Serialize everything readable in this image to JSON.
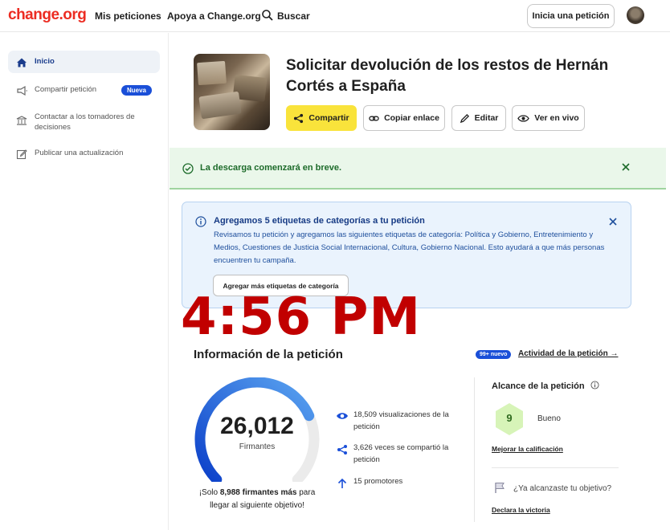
{
  "topnav": {
    "logo": "change.org",
    "links": [
      "Mis peticiones",
      "Apoya a Change.org"
    ],
    "search_label": "Buscar",
    "start_petition_label": "Inicia una petición"
  },
  "sidebar": {
    "items": [
      {
        "label": "Inicio",
        "icon": "home-icon",
        "active": true
      },
      {
        "label": "Compartir petición",
        "icon": "megaphone-icon",
        "badge": "Nueva"
      },
      {
        "label": "Contactar a los tomadores de decisiones",
        "icon": "building-icon"
      },
      {
        "label": "Publicar una actualización",
        "icon": "edit-icon"
      }
    ]
  },
  "petition": {
    "title": "Solicitar devolución de los restos de Hernán Cortés a España",
    "actions": [
      "Compartir",
      "Copiar enlace",
      "Editar",
      "Ver en vivo"
    ]
  },
  "success_banner": {
    "text": "La descarga comenzará en breve."
  },
  "info_box": {
    "title": "Agregamos 5 etiquetas de categorías a tu petición",
    "body": "Revisamos tu petición y agregamos las siguientes etiquetas de categoría: Política y Gobierno, Entretenimiento y Medios, Cuestiones de Justicia Social Internacional, Cultura, Gobierno Nacional. Esto ayudará a que más personas encuentren tu campaña.",
    "button_label": "Agregar más etiquetas de categoría"
  },
  "clock_overlay": "4:56 PM",
  "petition_info": {
    "section_title": "Información de la petición",
    "activity_badge": "99+ nuevo",
    "activity_link": "Actividad de la petición →",
    "signatures": "26,012",
    "signatures_label": "Firmantes",
    "signatures_progress": 0.743,
    "goal_prefix": "¡Solo ",
    "goal_count": "8,988 firmantes más",
    "goal_suffix": " para llegar al siguiente objetivo!",
    "stats": [
      {
        "icon": "eye-icon",
        "text": "18,509 visualizaciones de la petición"
      },
      {
        "icon": "share-icon",
        "text": "3,626 veces se compartió la petición"
      },
      {
        "icon": "arrow-up-icon",
        "text": "15 promotores"
      }
    ]
  },
  "reach": {
    "title": "Alcance de la petición",
    "score": "9",
    "score_label": "Bueno",
    "improve_link": "Mejorar la calificación",
    "goal_question": "¿Ya alcanzaste tu objetivo?",
    "declare_link": "Declara la victoria"
  },
  "colors": {
    "brand": "#ec2c22",
    "share_button": "#f9e33b",
    "badge_blue": "#1a4fd8",
    "success_bg": "#eaf7ea",
    "info_bg": "#eaf3fd",
    "gauge_start": "#0b3fc9",
    "gauge_end": "#5aa3f0",
    "clock": "#c10000"
  }
}
